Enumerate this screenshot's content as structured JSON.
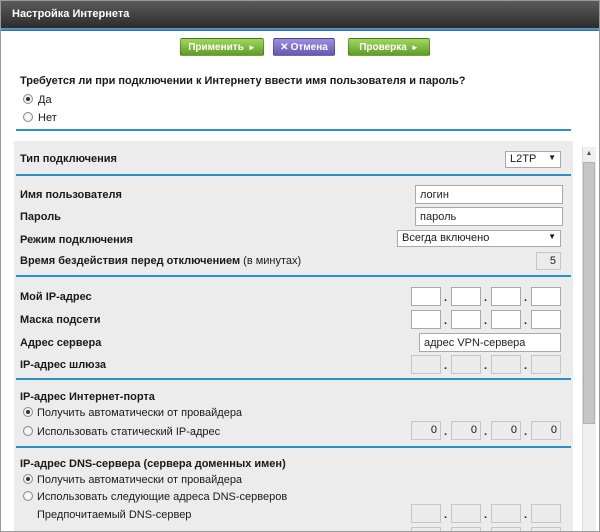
{
  "window": {
    "title": "Настройка Интернета"
  },
  "buttons": {
    "apply": "Применить",
    "cancel": "Отмена",
    "check": "Проверка"
  },
  "login_question": {
    "text": "Требуется ли при подключении к Интернету ввести имя пользователя и пароль?",
    "options": [
      "Да",
      "Нет"
    ],
    "selected": "Да"
  },
  "connection_type": {
    "label": "Тип подключения",
    "value": "L2TP"
  },
  "auth": {
    "username_label": "Имя пользователя",
    "username_value": "логин",
    "password_label": "Пароль",
    "password_value": "пароль",
    "mode_label": "Режим подключения",
    "mode_value": "Всегда включено",
    "idle_label_bold": "Время бездействия перед отключением",
    "idle_label_rest": "(в минутах)",
    "idle_value": "5"
  },
  "vpn": {
    "my_ip_label": "Мой IP-адрес",
    "subnet_mask_label": "Маска подсети",
    "server_address_label": "Адрес сервера",
    "server_address_value": "адрес VPN-сервера",
    "gateway_label": "IP-адрес шлюза"
  },
  "internet_port_ip": {
    "heading": "IP-адрес Интернет-порта",
    "options": [
      "Получить автоматически от провайдера",
      "Использовать статический IP-адрес"
    ],
    "selected": "Получить автоматически от провайдера",
    "static_ip": [
      "0",
      "0",
      "0",
      "0"
    ]
  },
  "dns": {
    "heading": "IP-адрес DNS-сервера (сервера доменных имен)",
    "options": [
      "Получить автоматически от провайдера",
      "Использовать следующие адреса DNS-серверов"
    ],
    "selected": "Получить автоматически от провайдера",
    "preferred_label": "Предпочитаемый DNS-сервер"
  },
  "icons": {
    "arrow": "play-arrow-icon",
    "cross": "cross-icon",
    "dropdown": "triangle-down-icon"
  },
  "colors": {
    "accent_line": "#2a90c8",
    "green_button": "#7dbb3f",
    "purple_button": "#7e6cc9",
    "titlebar": "#3a3a3a"
  }
}
